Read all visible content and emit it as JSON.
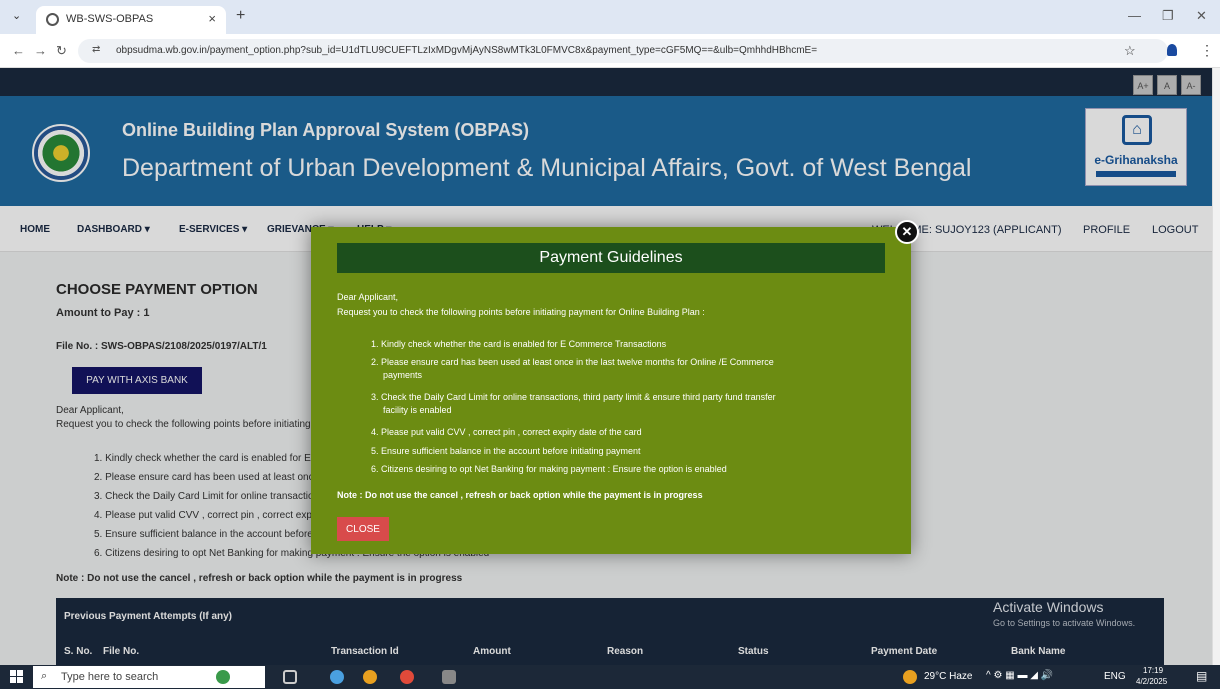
{
  "browser": {
    "tab_title": "WB-SWS-OBPAS",
    "tab_close": "×",
    "new_tab": "+",
    "url": "obpsudma.wb.gov.in/payment_option.php?sub_id=U1dTLU9CUEFTLzIxMDgvMjAyNS8wMTk3L0FMVC8x&payment_type=cGF5MQ==&ulb=QmhhdHBhcmE="
  },
  "header": {
    "font_controls": [
      "A+",
      "A",
      "A-"
    ],
    "system_title": "Online Building Plan Approval System (OBPAS)",
    "department": "Department of Urban Development & Municipal Affairs, Govt. of West Bengal",
    "brand_logo": "e-Grihanaksha"
  },
  "menu": {
    "items": [
      "HOME",
      "DASHBOARD ▾",
      "E-SERVICES ▾",
      "GRIEVANCE ▾",
      "HELP ▾"
    ],
    "welcome": "WELCOME: SUJOY123 (APPLICANT)",
    "profile": "PROFILE",
    "logout": "LOGOUT"
  },
  "page": {
    "heading": "CHOOSE PAYMENT OPTION",
    "amount": "Amount to Pay : 1",
    "file_no": "File No. : SWS-OBPAS/2108/2025/0197/ALT/1",
    "pay_button": "PAY WITH AXIS BANK",
    "greeting": "Dear Applicant,",
    "request": "Request you to check the following points before initiating payment for Online Building Plan :",
    "points": [
      "1. Kindly check whether the card is enabled for E Commerce Transactions",
      "2. Please ensure card has been used at least once in the last twelve months for Online /E Commerce payments",
      "3. Check the Daily Card Limit for online transactions, third party limit & ensure third party fund transfer facility is enabled",
      "4. Please put valid CVV , correct pin , correct expiry date of the card",
      "5. Ensure sufficient balance in the account before initiating payment",
      "6. Citizens desiring to opt Net Banking for making payment : Ensure the option is enabled"
    ],
    "note": "Note : Do not use the cancel , refresh or back option while the payment is in progress",
    "table_title": "Previous Payment Attempts (If any)",
    "table_headers": [
      "S. No.",
      "File No.",
      "Transaction Id",
      "Amount",
      "Reason",
      "Status",
      "Payment Date",
      "Bank Name"
    ]
  },
  "modal": {
    "title": "Payment Guidelines",
    "greeting": "Dear Applicant,",
    "request": "Request you to check the following points before initiating payment for Online Building Plan :",
    "lines": [
      "1. Kindly check whether the card is enabled for E Commerce Transactions",
      "2. Please ensure card has been used at least once in the last twelve months for Online /E Commerce",
      "payments",
      "3. Check the Daily Card Limit for online transactions, third party limit & ensure third party fund transfer",
      "facility is enabled",
      "4. Please put valid CVV , correct pin , correct expiry date of the card",
      "5. Ensure sufficient balance in the account before initiating payment",
      "6. Citizens desiring to opt Net Banking for making payment : Ensure the option is enabled"
    ],
    "note": "Note : Do not use the cancel , refresh or back option while the payment is in progress",
    "close_button": "CLOSE",
    "close_x": "✕"
  },
  "watermark": {
    "title": "Activate Windows",
    "subtitle": "Go to Settings to activate Windows."
  },
  "taskbar": {
    "search_placeholder": "Type here to search",
    "weather": "29°C Haze",
    "language": "ENG",
    "time": "17:19",
    "date": "4/2/2025"
  },
  "colors": {
    "banner": "#1f6aa0",
    "modal_bg": "#6c8c12",
    "modal_header": "#1c4f1c",
    "close_button": "#d84b4b",
    "pay_button": "#141466",
    "table_header": "#1a2a3f"
  }
}
